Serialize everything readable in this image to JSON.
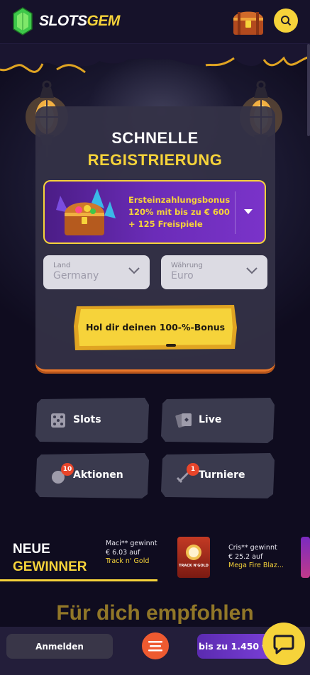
{
  "header": {
    "brand_part1": "SLOTS",
    "brand_part2": "GEM"
  },
  "registration": {
    "title_line1": "SCHNELLE",
    "title_line2": "REGISTRIERUNG",
    "bonus_text": "Ersteinzahlungsbonus 120% mit bis zu € 600 + 125 Freispiele",
    "country": {
      "label": "Land",
      "value": "Germany"
    },
    "currency": {
      "label": "Währung",
      "value": "Euro"
    },
    "cta_label": "Hol dir deinen 100-%-Bonus"
  },
  "categories": [
    {
      "label": "Slots"
    },
    {
      "label": "Live"
    },
    {
      "label": "Aktionen",
      "badge": "10"
    },
    {
      "label": "Turniere",
      "badge": "1"
    }
  ],
  "winners": {
    "title_line1": "NEUE",
    "title_line2": "GEWINNER",
    "items": [
      {
        "name": "Maci** gewinnt",
        "amount": "€ 6.03 auf",
        "game": "Track n' Gold"
      },
      {
        "name": "Cris** gewinnt",
        "amount": "€ 25.2 auf",
        "game": "Mega Fire Blaz..."
      }
    ],
    "thumb_text": "TRACK N'GOLD"
  },
  "recommended_title": "Für dich empfohlen",
  "bottom": {
    "login_label": "Anmelden",
    "promo_label": "bis zu 1.450 €"
  },
  "colors": {
    "accent_yellow": "#f6d33a",
    "accent_orange": "#e8772a",
    "purple": "#6b2cb8",
    "background": "#0f0c1f"
  }
}
